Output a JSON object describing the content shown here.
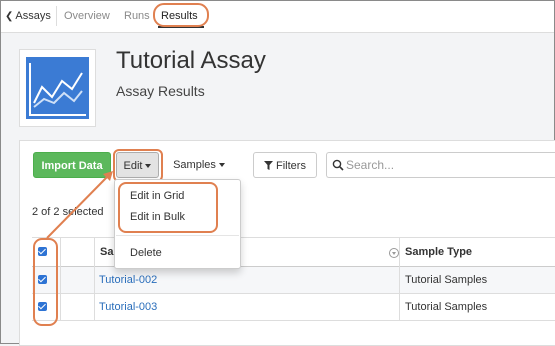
{
  "nav": {
    "back_label": "Assays",
    "tabs": [
      "Overview",
      "Runs",
      "Results"
    ]
  },
  "header": {
    "title": "Tutorial Assay",
    "subtitle": "Assay Results"
  },
  "toolbar": {
    "import_label": "Import Data",
    "edit_label": "Edit",
    "samples_label": "Samples",
    "filters_label": "Filters",
    "search_placeholder": "Search..."
  },
  "selection_text": "2 of 2 selected",
  "edit_menu": {
    "items": [
      "Edit in Grid",
      "Edit in Bulk",
      "Delete"
    ]
  },
  "table": {
    "columns": [
      "Sa",
      "Sample Type"
    ],
    "rows": [
      {
        "sample": "Tutorial-002",
        "type": "Tutorial Samples",
        "checked": true
      },
      {
        "sample": "Tutorial-003",
        "type": "Tutorial Samples",
        "checked": true
      }
    ]
  },
  "colors": {
    "accent": "#3b7bd4",
    "import_button": "#5cb85c",
    "link": "#2a6ebb",
    "annotation": "#e08050"
  },
  "icons": [
    "chevron-left-icon",
    "caret-down-icon",
    "filter-icon",
    "search-icon",
    "sort-menu-icon",
    "checkbox-icon",
    "assay-chart-icon"
  ]
}
